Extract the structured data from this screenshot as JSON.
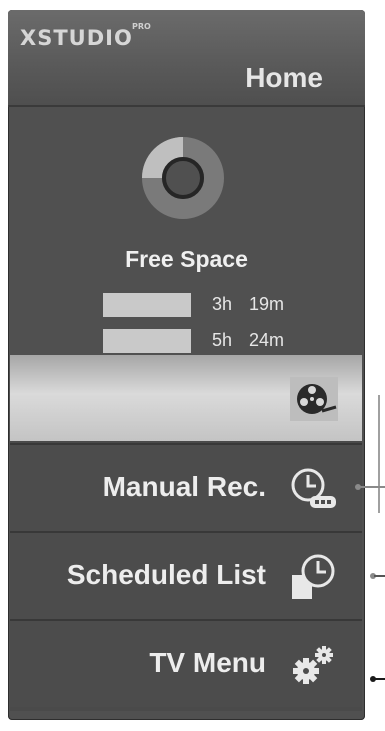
{
  "header": {
    "brand": "XSTUDIO",
    "brand_badge": "PRO",
    "title": "Home"
  },
  "storage": {
    "label": "Free Space",
    "used_fraction": 0.25,
    "rows": [
      {
        "time": "3h 19m"
      },
      {
        "time": "5h 24m"
      }
    ]
  },
  "menu": {
    "items": [
      {
        "label": "",
        "icon": "film-reel-icon",
        "selected": true
      },
      {
        "label": "Manual Rec.",
        "icon": "clock-record-icon",
        "selected": false
      },
      {
        "label": "Scheduled List",
        "icon": "clock-list-icon",
        "selected": false
      },
      {
        "label": "TV Menu",
        "icon": "gears-icon",
        "selected": false
      }
    ]
  },
  "colors": {
    "panel": "#505050",
    "header": "#5f5f5f",
    "selected": "#d0d0d0",
    "text": "#ededed"
  }
}
